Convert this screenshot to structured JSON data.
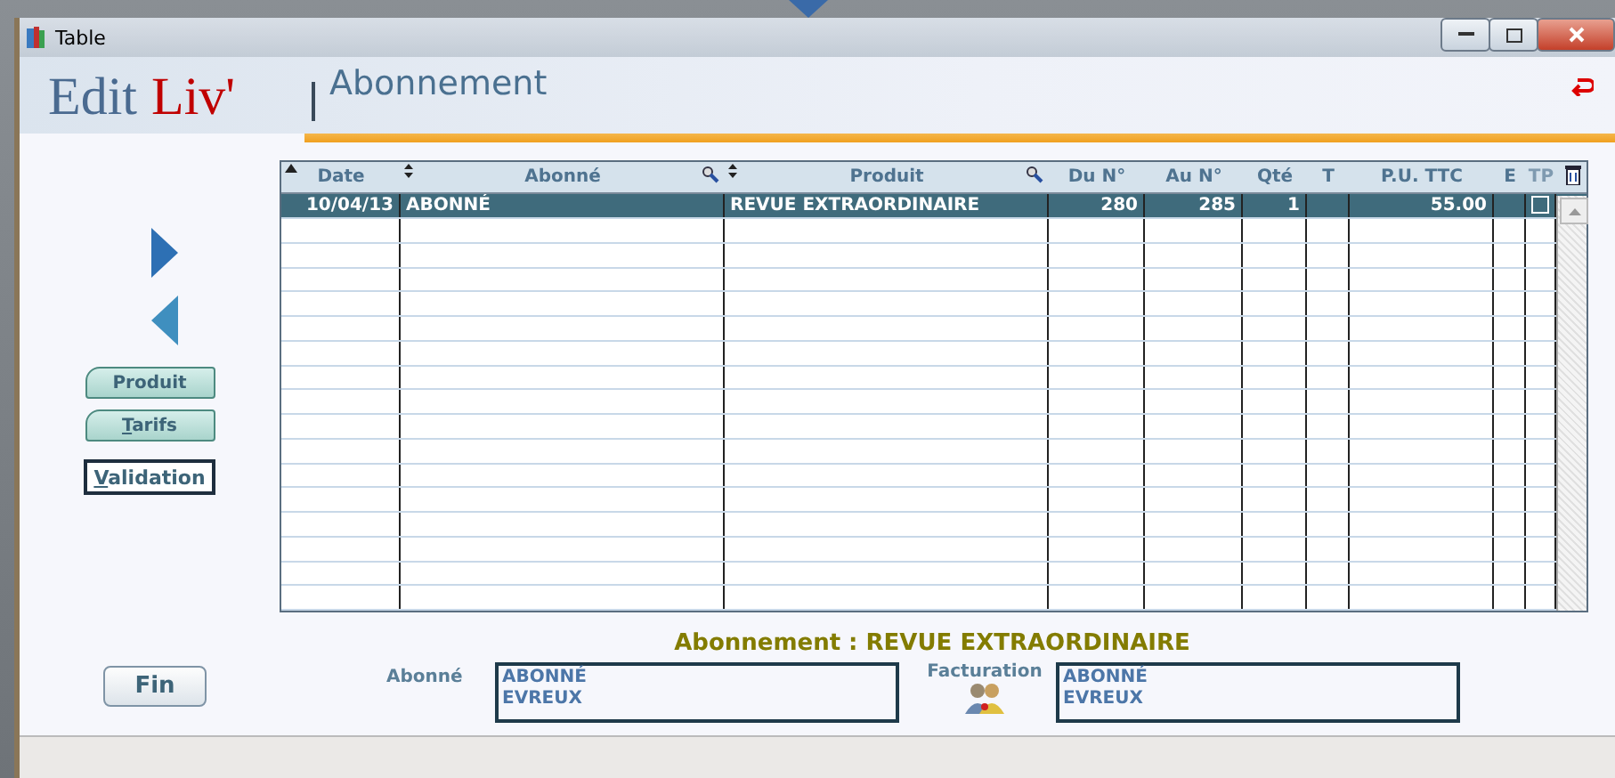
{
  "window": {
    "title": "Table"
  },
  "header": {
    "logo_first": "Edit",
    "logo_second": "Liv'",
    "title": "Abonnement"
  },
  "nav": [
    {
      "kind": "next"
    },
    {
      "kind": "previous"
    }
  ],
  "side_buttons": [
    {
      "label": "Produit",
      "kind": "tab",
      "underlined_initial": false
    },
    {
      "label": "Tarifs",
      "kind": "tab",
      "underlined_initial": true
    },
    {
      "label": "Validation",
      "kind": "framed",
      "underlined_initial": true
    }
  ],
  "table": {
    "columns": [
      {
        "label": "Date",
        "kind": "number",
        "sortable": true,
        "sorted": true,
        "search": false,
        "dimmed": false
      },
      {
        "label": "Abonné",
        "kind": "text",
        "sortable": true,
        "search": true,
        "dimmed": false
      },
      {
        "label": "Produit",
        "kind": "text",
        "sortable": true,
        "search": true,
        "dimmed": false
      },
      {
        "label": "Du N°",
        "kind": "number",
        "sortable": false,
        "search": false,
        "dimmed": false
      },
      {
        "label": "Au N°",
        "kind": "number",
        "sortable": false,
        "search": false,
        "dimmed": false
      },
      {
        "label": "Qté",
        "kind": "number",
        "sortable": false,
        "search": false,
        "dimmed": false
      },
      {
        "label": "T",
        "kind": "text",
        "sortable": false,
        "search": false,
        "dimmed": false
      },
      {
        "label": "P.U. TTC",
        "kind": "number",
        "sortable": false,
        "search": false,
        "dimmed": false
      },
      {
        "label": "E",
        "kind": "text",
        "sortable": false,
        "search": false,
        "dimmed": false
      },
      {
        "label": "TP",
        "kind": "checkbox",
        "sortable": false,
        "search": false,
        "dimmed": true
      }
    ],
    "rows": [
      {
        "selected": true,
        "cells": [
          "10/04/13",
          "ABONNÉ",
          "REVUE EXTRAORDINAIRE",
          "280",
          "285",
          "1",
          "",
          "55.00",
          ""
        ],
        "tp_checked": false
      }
    ]
  },
  "caption": "Abonnement : REVUE EXTRAORDINAIRE",
  "abonne": {
    "label": "Abonné",
    "lines": [
      "ABONNÉ",
      "EVREUX"
    ]
  },
  "facturation": {
    "label": "Facturation",
    "lines": [
      "ABONNÉ",
      "EVREUX"
    ]
  },
  "fin_button": "Fin"
}
